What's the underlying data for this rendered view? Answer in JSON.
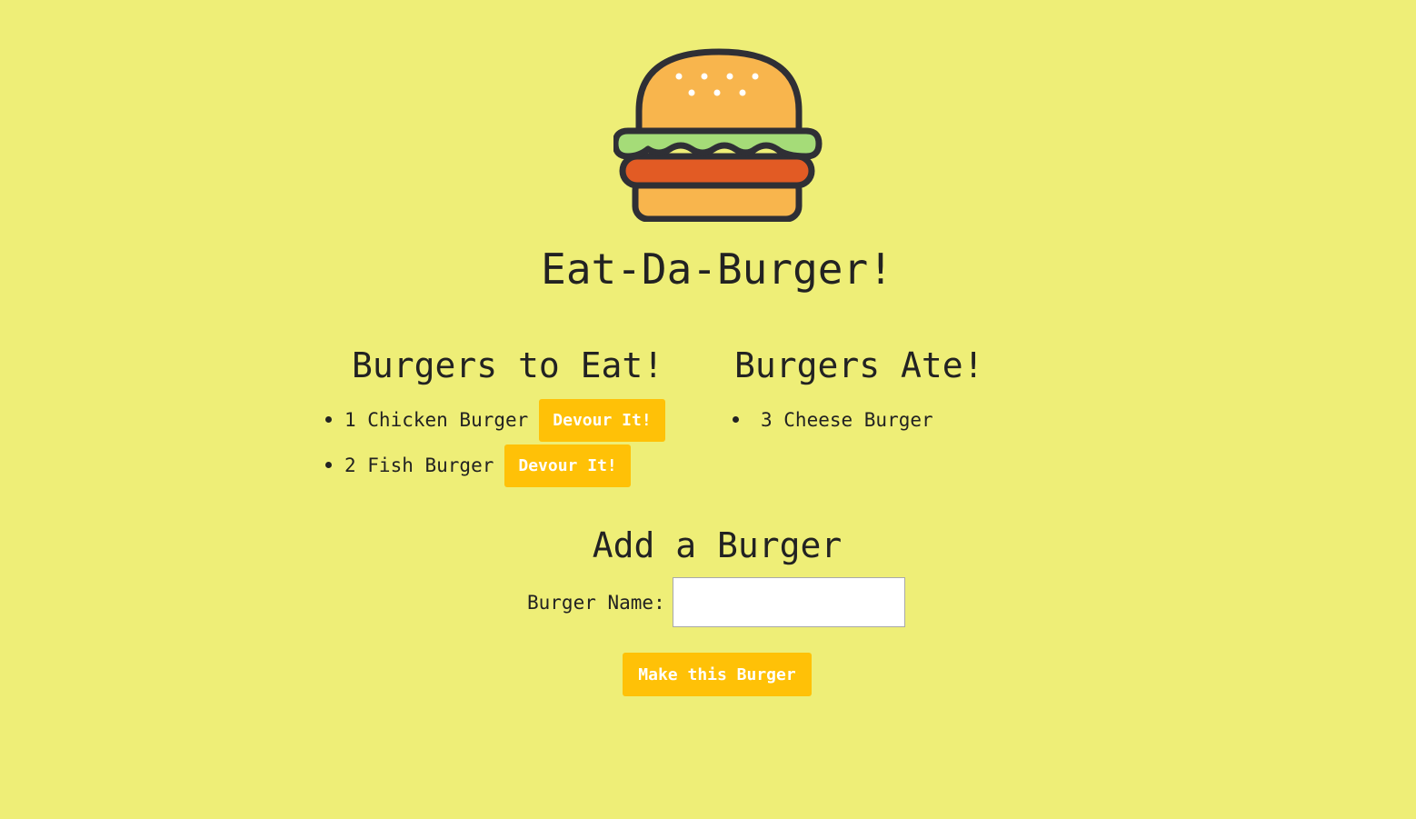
{
  "header": {
    "logo_icon": "burger-icon",
    "title": "Eat-Da-Burger!"
  },
  "to_eat": {
    "heading": "Burgers to Eat!",
    "items": [
      {
        "label": "1 Chicken Burger",
        "button": "Devour It!"
      },
      {
        "label": "2 Fish Burger",
        "button": "Devour It!"
      }
    ]
  },
  "eaten": {
    "heading": "Burgers Ate!",
    "items": [
      {
        "label": "3 Cheese Burger"
      }
    ]
  },
  "add_form": {
    "heading": "Add a Burger",
    "field_label": "Burger Name:",
    "field_value": "",
    "submit_label": "Make this Burger"
  },
  "colors": {
    "background": "#eeee77",
    "button": "#ffc107",
    "button_text": "#ffffff",
    "text": "#222222"
  }
}
